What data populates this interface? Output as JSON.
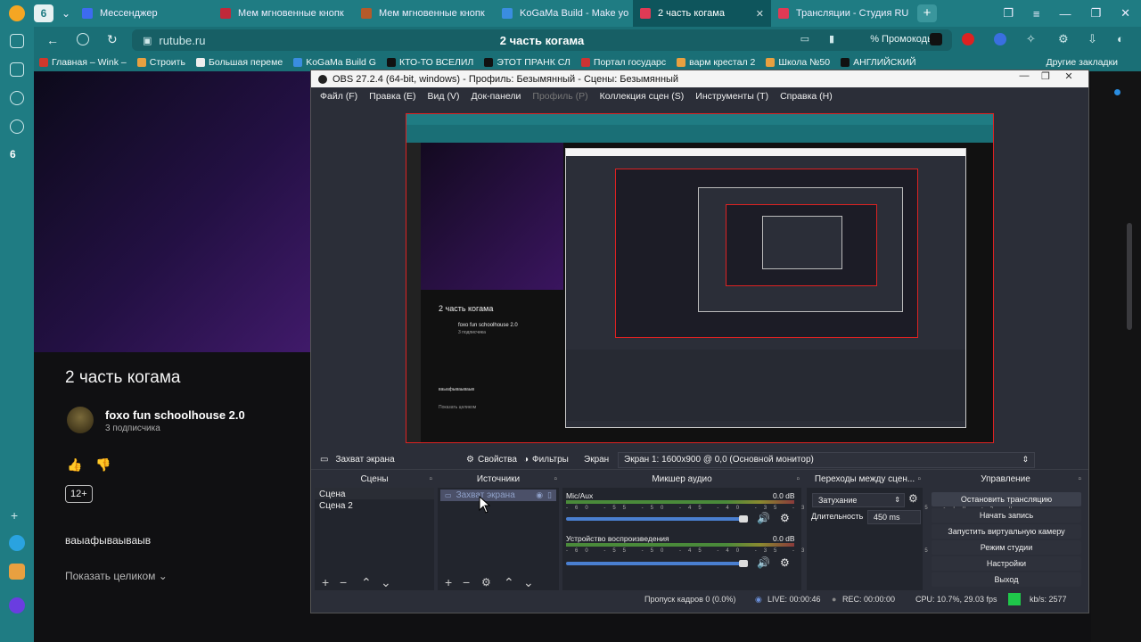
{
  "browser": {
    "tabs": [
      {
        "label": "Мессенджер",
        "color": "#3d6bf0",
        "active": false
      },
      {
        "label": "Мем мгновенные кнопк",
        "color": "#c0283a",
        "active": false
      },
      {
        "label": "Мем мгновенные кнопк",
        "color": "#b45a2a",
        "active": false
      },
      {
        "label": "KoGaMa Build - Make yo",
        "color": "#3a8de0",
        "active": false
      },
      {
        "label": "2 часть когама",
        "color": "#e03a55",
        "active": true
      },
      {
        "label": "Трансляции - Студия RU",
        "color": "#e03a55",
        "active": false
      }
    ],
    "tab_count": "6",
    "url": "rutube.ru",
    "page_title": "2 часть когама",
    "promo": "Промокоды",
    "bookmarks": [
      "Главная – Wink –",
      "Строить",
      "Большая переме",
      "KoGaMa Build G",
      "КТО-ТО ВСЕЛИЛ",
      "ЭТОТ ПРАНК СЛ",
      "Портал государс",
      "варм крестал 2",
      "Школа №50",
      "АНГЛИЙСКИЙ",
      "Другие закладки"
    ],
    "sidebar_num": "6"
  },
  "rutube": {
    "video_title": "2 часть когама",
    "channel_name": "foxo fun schoolhouse 2.0",
    "channel_subs": "3 подписчика",
    "age": "12+",
    "description": "ваыафываываыв",
    "show_all": "Показать целиком ⌄"
  },
  "obs": {
    "title": "OBS 27.2.4 (64-bit, windows) - Профиль: Безымянный - Сцены: Безымянный",
    "menu": [
      "Файл (F)",
      "Правка (E)",
      "Вид (V)",
      "Док-панели",
      "Профиль (P)",
      "Коллекция сцен (S)",
      "Инструменты (T)",
      "Справка (H)"
    ],
    "toolbar": {
      "source": "Захват экрана",
      "properties": "Свойства",
      "filters": "Фильтры",
      "screen_label": "Экран",
      "screen_value": "Экран 1: 1600x900 @ 0,0 (Основной монитор)"
    },
    "docks": {
      "scenes_header": "Сцены",
      "sources_header": "Источники",
      "mixer_header": "Микшер аудио",
      "transitions_header": "Переходы между сцен...",
      "controls_header": "Управление"
    },
    "scenes": [
      "Сцена",
      "Сцена 2"
    ],
    "sources": [
      "Захват экрана"
    ],
    "mixer": [
      {
        "name": "Mic/Aux",
        "db": "0.0 dB"
      },
      {
        "name": "Устройство воспроизведения",
        "db": "0.0 dB"
      }
    ],
    "mixer_scale": "-60 -55 -50 -45 -40 -35 -30 -25 -20 -15 -10 -5 0",
    "transitions": {
      "type": "Затухание",
      "duration_label": "Длительность",
      "duration_value": "450 ms"
    },
    "controls": [
      "Остановить трансляцию",
      "Начать запись",
      "Запустить виртуальную камеру",
      "Режим студии",
      "Настройки",
      "Выход"
    ],
    "status": {
      "dropped": "Пропуск кадров 0 (0.0%)",
      "live": "LIVE: 00:00:46",
      "rec": "REC: 00:00:00",
      "cpu": "CPU: 10.7%, 29.03 fps",
      "kbs": "kb/s: 2577"
    }
  },
  "preview_inner": {
    "title": "2 часть когама",
    "channel": "foxo fun schoolhouse 2.0",
    "subs": "3 подписчика",
    "desc": "ваыафываываыв",
    "show": "Показать целиком"
  }
}
